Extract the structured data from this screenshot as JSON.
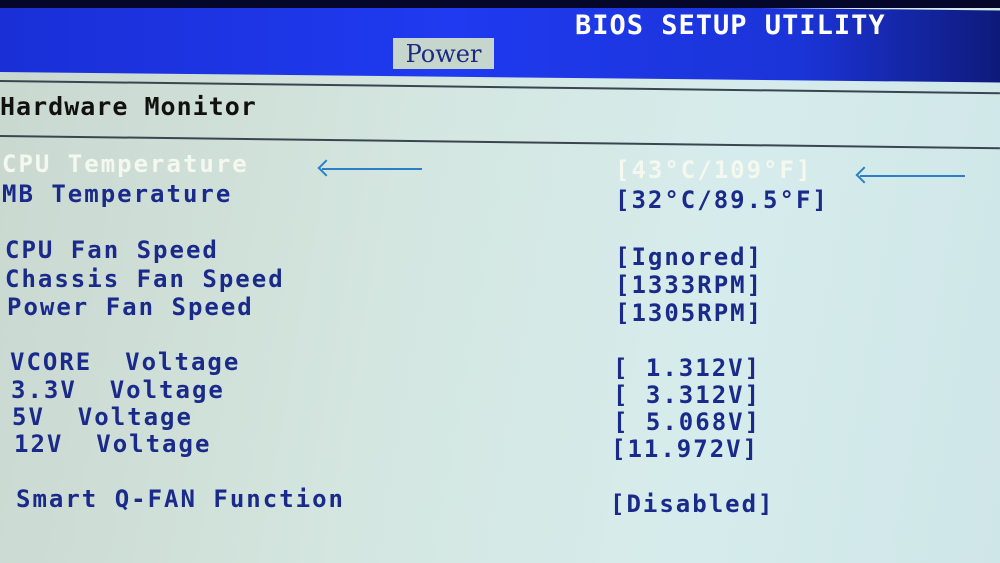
{
  "header": {
    "title": "BIOS SETUP UTILITY",
    "active_tab": "Power"
  },
  "section": {
    "title": "Hardware Monitor"
  },
  "items": [
    {
      "label": "CPU Temperature",
      "value": "[43°C/109°F]",
      "selected": true
    },
    {
      "label": "MB Temperature",
      "value": "[32°C/89.5°F]",
      "selected": false
    },
    {
      "label": "CPU Fan Speed",
      "value": "[Ignored]",
      "selected": false
    },
    {
      "label": "Chassis Fan Speed",
      "value": "[1333RPM]",
      "selected": false
    },
    {
      "label": "Power Fan Speed",
      "value": "[1305RPM]",
      "selected": false
    },
    {
      "label": "VCORE  Voltage",
      "value": "[ 1.312V]",
      "selected": false
    },
    {
      "label": "3.3V  Voltage",
      "value": "[ 3.312V]",
      "selected": false
    },
    {
      "label": "5V  Voltage",
      "value": "[ 5.068V]",
      "selected": false
    },
    {
      "label": "12V  Voltage",
      "value": "[11.972V]",
      "selected": false
    },
    {
      "label": "Smart Q-FAN Function",
      "value": "[Disabled]",
      "selected": false
    }
  ],
  "annotations": {
    "arrow_icon": "left-arrow-icon"
  },
  "colors": {
    "header_blue": "#1f3af0",
    "text_blue": "#1a2a8a",
    "selected_text": "#f4f8ee",
    "arrow": "#2b7fc6"
  }
}
